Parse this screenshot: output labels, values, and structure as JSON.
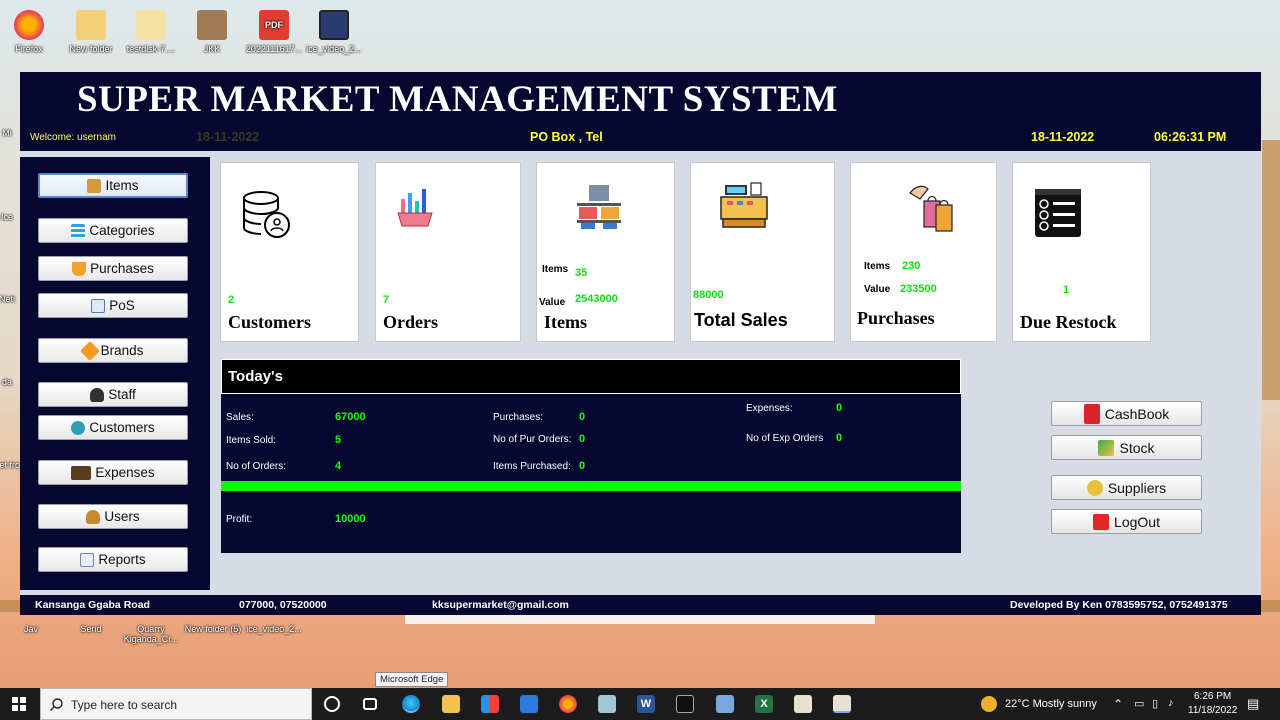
{
  "desktop": {
    "icons_top": [
      "Firefox",
      "New folder",
      "testdisk-7....",
      "JKK",
      "2022111617...",
      "ice_video_2..."
    ],
    "icons_bottom": [
      "Jav",
      "Send",
      "Quarry Kiganda_Cr...",
      "New folder (5)",
      "ice_video_2..."
    ],
    "left_partial": [
      "Mi",
      "Ice",
      "Neti",
      "da",
      "Fet fro"
    ]
  },
  "header": {
    "title": "SUPER MARKET MANAGEMENT SYSTEM",
    "welcome": "Welcome:  usernam",
    "ghost_date": "18-11-2022",
    "po_box": "PO Box , Tel",
    "date": "18-11-2022",
    "time": "06:26:31 PM"
  },
  "sidebar": {
    "items": [
      {
        "label": "Items",
        "icon": "box-icon"
      },
      {
        "label": "Categories",
        "icon": "list-icon"
      },
      {
        "label": "Purchases",
        "icon": "cart-icon"
      },
      {
        "label": "PoS",
        "icon": "pos-icon"
      },
      {
        "label": "Brands",
        "icon": "brands-icon"
      },
      {
        "label": "Staff",
        "icon": "staff-icon"
      },
      {
        "label": "Customers",
        "icon": "customers-icon"
      },
      {
        "label": "Expenses",
        "icon": "wallet-icon"
      },
      {
        "label": "Users",
        "icon": "users-icon"
      },
      {
        "label": "Reports",
        "icon": "reports-icon"
      }
    ]
  },
  "cards": {
    "customers": {
      "value": "2",
      "title": "Customers"
    },
    "orders": {
      "value": "7",
      "title": "Orders"
    },
    "items": {
      "items_label": "Items",
      "items_value": "35",
      "value_label": "Value",
      "value_value": "2543000",
      "title": "Items"
    },
    "total_sales": {
      "value": "88000",
      "title": "Total Sales"
    },
    "purchases": {
      "items_label": "Items",
      "items_value": "230",
      "value_label": "Value",
      "value_value": "233500",
      "title": "Purchases"
    },
    "due_restock": {
      "value": "1",
      "title": "Due Restock"
    }
  },
  "today": {
    "title": "Today's",
    "sales_label": "Sales:",
    "sales": "67000",
    "items_sold_label": "Items Sold:",
    "items_sold": "5",
    "orders_label": "No of Orders:",
    "orders": "4",
    "purchases_label": "Purchases:",
    "purchases": "0",
    "pur_orders_label": "No of Pur Orders:",
    "pur_orders": "0",
    "items_purchased_label": "Items Purchased:",
    "items_purchased": "0",
    "expenses_label": "Expenses:",
    "expenses": "0",
    "exp_orders_label": "No of Exp Orders",
    "exp_orders": "0",
    "profit_label": "Profit:",
    "profit": "10000"
  },
  "right_buttons": {
    "cashbook": "CashBook",
    "stock": "Stock",
    "suppliers": "Suppliers",
    "logout": "LogOut"
  },
  "footer": {
    "address": "Kansanga Ggaba Road",
    "phones": "077000, 07520000",
    "email": "kksupermarket@gmail.com",
    "developer": "Developed By Ken 0783595752, 0752491375"
  },
  "tooltip": "Microsoft Edge",
  "taskbar": {
    "search_placeholder": "Type here to search",
    "weather": "22°C  Mostly sunny",
    "time": "6:26 PM",
    "date": "11/18/2022"
  },
  "colors": {
    "navy": "#07082f",
    "green": "#10e010",
    "yellow": "#ffff44"
  }
}
